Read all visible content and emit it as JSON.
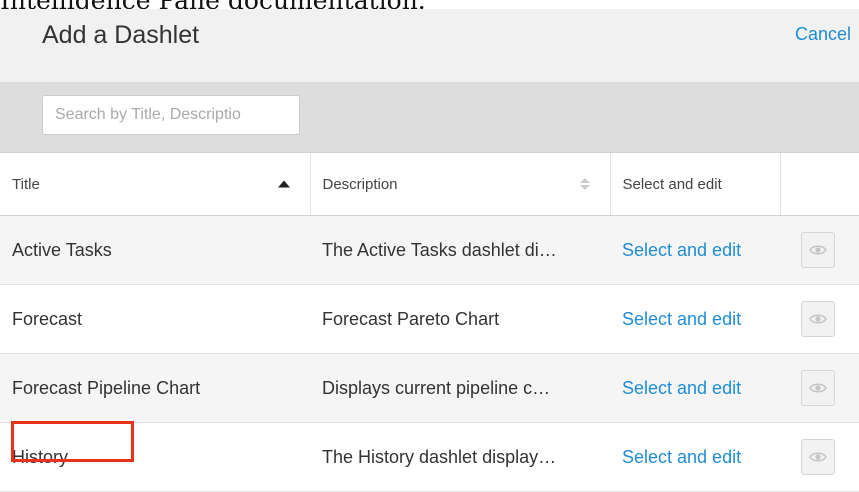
{
  "caption": "Intelligence Pane documentation.",
  "dialog": {
    "title": "Add a Dashlet",
    "cancel_label": "Cancel"
  },
  "search": {
    "placeholder": "Search by Title, Descriptio"
  },
  "table": {
    "columns": {
      "title": "Title",
      "description": "Description",
      "select": "Select and edit"
    },
    "sort": {
      "column": "Title",
      "direction": "ascending"
    },
    "rows": [
      {
        "title": "Active Tasks",
        "description": "The Active Tasks dashlet di…",
        "action": "Select and edit",
        "preview_icon": "eye-icon"
      },
      {
        "title": "Forecast",
        "description": "Forecast Pareto Chart",
        "action": "Select and edit",
        "preview_icon": "eye-icon"
      },
      {
        "title": "Forecast Pipeline Chart",
        "description": "Displays current pipeline c…",
        "action": "Select and edit",
        "preview_icon": "eye-icon"
      },
      {
        "title": "History",
        "description": "The History dashlet display…",
        "action": "Select and edit",
        "preview_icon": "eye-icon"
      }
    ]
  },
  "annotation": {
    "highlighted_item": "History",
    "color": "#e8331c"
  },
  "colors": {
    "link": "#1f8dd6",
    "header_bg": "#f1f1f1",
    "search_bar_bg": "#dddddd",
    "row_alt_bg": "#f5f5f5"
  }
}
